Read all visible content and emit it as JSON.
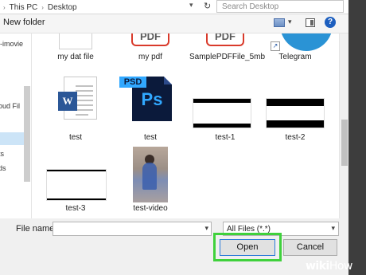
{
  "address": {
    "crumbs": [
      "This PC",
      "Desktop"
    ],
    "search_placeholder": "Search Desktop"
  },
  "toolbar": {
    "new_folder": "New folder"
  },
  "nav": {
    "items": [
      "l-imovie",
      "oud Fil",
      "ts",
      "ds"
    ]
  },
  "files": {
    "row1": [
      "my dat file",
      "my pdf",
      "SamplePDFFile_5mb",
      "Telegram"
    ],
    "row1_pdf_text": "PDF",
    "row2": [
      "test",
      "test",
      "test-1",
      "test-2"
    ],
    "row3": [
      "test-3",
      "test-video"
    ],
    "psd_tag": "PSD",
    "ps_text": "Ps",
    "word_letter": "W"
  },
  "bottom": {
    "file_name_label": "File name:",
    "file_name_value": "",
    "filter_value": "All Files (*.*)",
    "open_label": "Open",
    "cancel_label": "Cancel"
  },
  "watermark": {
    "wiki": "wiki",
    "how": "How"
  },
  "colors": {
    "highlight": "#3fd13c",
    "accent_blue": "#2a7ad8",
    "pdf_red": "#d93a2b"
  }
}
